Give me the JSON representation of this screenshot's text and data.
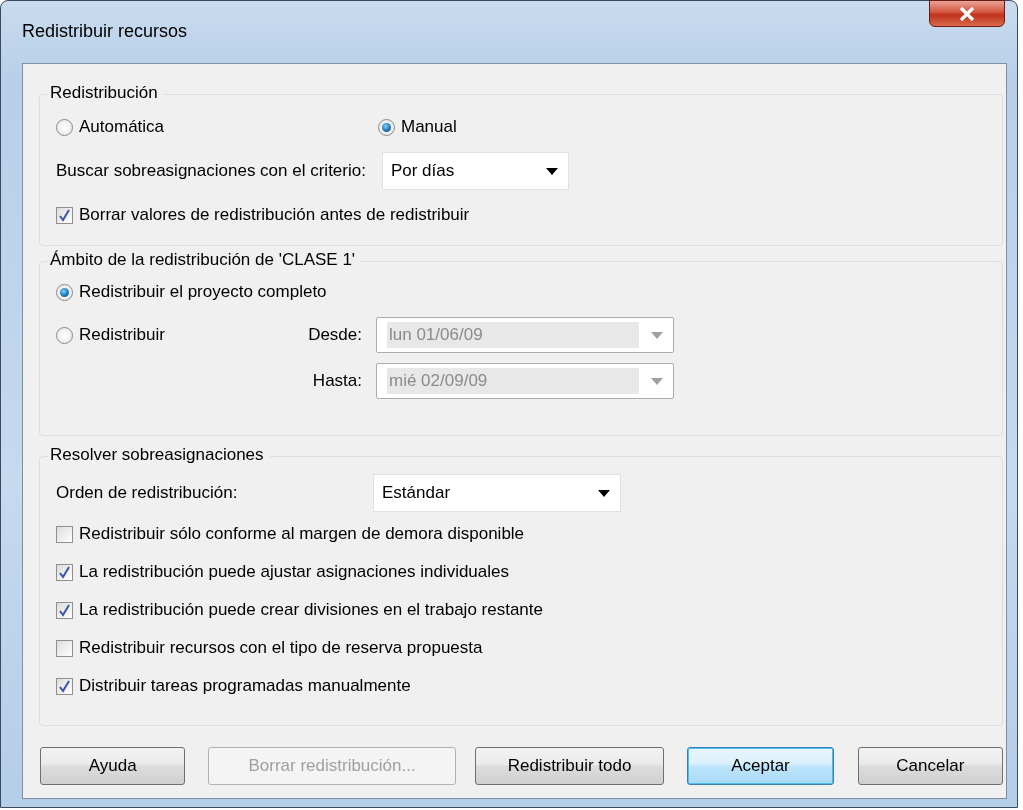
{
  "window": {
    "title": "Redistribuir recursos"
  },
  "redistribution": {
    "title": "Redistribución",
    "modes": [
      {
        "label": "Automática",
        "selected": false
      },
      {
        "label": "Manual",
        "selected": true
      }
    ],
    "criterion": {
      "label": "Buscar sobreasignaciones con el criterio:",
      "value": "Por días"
    },
    "clear_values": {
      "label": "Borrar valores de redistribución antes de redistribuir",
      "checked": true
    }
  },
  "scope": {
    "title": "Ámbito de la redistribución de 'CLASE 1'",
    "options": [
      {
        "label": "Redistribuir el proyecto completo",
        "selected": true
      },
      {
        "label": "Redistribuir",
        "selected": false
      }
    ],
    "from": {
      "label": "Desde:",
      "value": "lun 01/06/09",
      "disabled": true
    },
    "to": {
      "label": "Hasta:",
      "value": "mié 02/09/09",
      "disabled": true
    }
  },
  "resolve": {
    "title": "Resolver sobreasignaciones",
    "order": {
      "label": "Orden de redistribución:",
      "value": "Estándar"
    },
    "options": [
      {
        "label": "Redistribuir sólo conforme al margen de demora disponible",
        "checked": false
      },
      {
        "label": "La redistribución puede ajustar asignaciones individuales",
        "checked": true
      },
      {
        "label": "La redistribución puede crear divisiones en el trabajo restante",
        "checked": true
      },
      {
        "label": "Redistribuir recursos con el tipo de reserva propuesta",
        "checked": false
      },
      {
        "label": "Distribuir tareas programadas manualmente",
        "checked": true
      }
    ]
  },
  "buttons": [
    {
      "label": "Ayuda",
      "disabled": false,
      "default": false
    },
    {
      "label": "Borrar redistribución...",
      "disabled": true,
      "default": false
    },
    {
      "label": "Redistribuir todo",
      "disabled": false,
      "default": false
    },
    {
      "label": "Aceptar",
      "disabled": false,
      "default": true
    },
    {
      "label": "Cancelar",
      "disabled": false,
      "default": false
    }
  ]
}
